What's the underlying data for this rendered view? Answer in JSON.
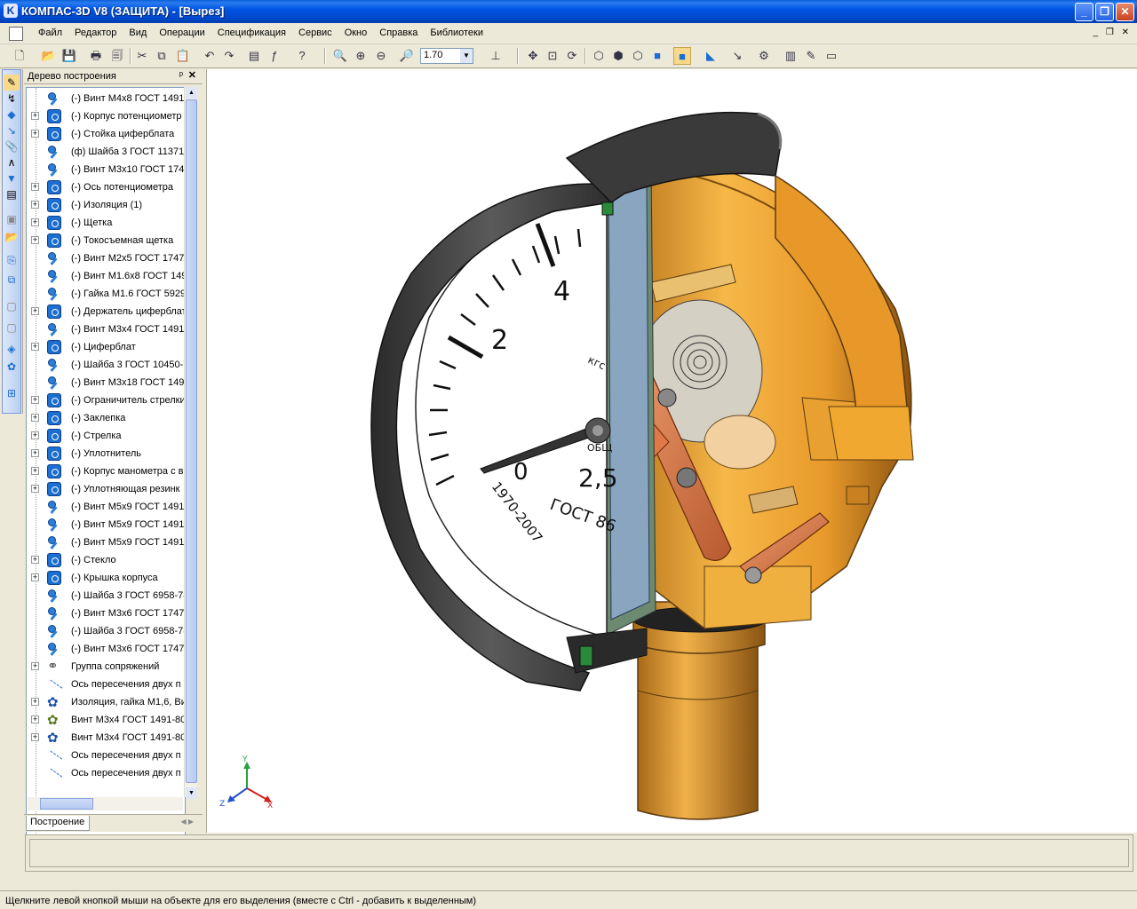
{
  "window": {
    "title": "КОМПАС-3D V8 (ЗАЩИТА) - [Вырез]",
    "minimize": "_",
    "maximize": "❐",
    "close": "✕"
  },
  "menu": [
    "Файл",
    "Редактор",
    "Вид",
    "Операции",
    "Спецификация",
    "Сервис",
    "Окно",
    "Справка",
    "Библиотеки"
  ],
  "toolbar": {
    "zoom_value": "1.70"
  },
  "tree": {
    "header": "Дерево построения",
    "tab": "Построение",
    "items": [
      {
        "label": "(-) Винт М4х8 ГОСТ 1491-",
        "icon": "bolt-icon",
        "expand": false
      },
      {
        "label": "(-) Корпус потенциометр",
        "icon": "part-icon",
        "expand": true
      },
      {
        "label": "(-) Стойка циферблата",
        "icon": "part-icon",
        "expand": true
      },
      {
        "label": "(ф) Шайба 3 ГОСТ 11371-",
        "icon": "bolt-icon",
        "expand": false
      },
      {
        "label": "(-) Винт М3х10 ГОСТ 1747",
        "icon": "bolt-icon",
        "expand": false
      },
      {
        "label": "(-) Ось потенциометра",
        "icon": "part-icon",
        "expand": true
      },
      {
        "label": "(-) Изоляция (1)",
        "icon": "part-icon",
        "expand": true
      },
      {
        "label": "(-) Щетка",
        "icon": "part-icon",
        "expand": true
      },
      {
        "label": "(-) Токосъемная щетка",
        "icon": "part-icon",
        "expand": true
      },
      {
        "label": "(-) Винт М2х5 ГОСТ 17473",
        "icon": "bolt-icon",
        "expand": false
      },
      {
        "label": "(-) Винт М1.6х8 ГОСТ 149",
        "icon": "bolt-icon",
        "expand": false
      },
      {
        "label": "(-) Гайка М1.6 ГОСТ 5929",
        "icon": "bolt-icon",
        "expand": false
      },
      {
        "label": "(-) Держатель циферблат",
        "icon": "part-icon",
        "expand": true
      },
      {
        "label": "(-) Винт М3х4 ГОСТ 1491-",
        "icon": "bolt-icon",
        "expand": false
      },
      {
        "label": "(-) Циферблат",
        "icon": "part-icon",
        "expand": true
      },
      {
        "label": "(-) Шайба 3 ГОСТ 10450-7",
        "icon": "bolt-icon",
        "expand": false
      },
      {
        "label": "(-) Винт М3х18 ГОСТ 149:",
        "icon": "bolt-icon",
        "expand": false
      },
      {
        "label": "(-) Ограничитель стрелки",
        "icon": "part-icon",
        "expand": true
      },
      {
        "label": "(-) Заклепка",
        "icon": "part-icon",
        "expand": true
      },
      {
        "label": "(-) Стрелка",
        "icon": "part-icon",
        "expand": true
      },
      {
        "label": "(-) Уплотнитель",
        "icon": "part-icon",
        "expand": true
      },
      {
        "label": "(-) Корпус манометра с в",
        "icon": "part-icon",
        "expand": true
      },
      {
        "label": "(-) Уплотняющая резинк",
        "icon": "part-icon",
        "expand": true
      },
      {
        "label": "(-) Винт М5х9 ГОСТ 1491-",
        "icon": "bolt-icon",
        "expand": false
      },
      {
        "label": "(-) Винт М5х9 ГОСТ 1491-",
        "icon": "bolt-icon",
        "expand": false
      },
      {
        "label": "(-) Винт М5х9 ГОСТ 1491-",
        "icon": "bolt-icon",
        "expand": false
      },
      {
        "label": "(-) Стекло",
        "icon": "part-icon",
        "expand": true
      },
      {
        "label": "(-) Крышка корпуса",
        "icon": "part-icon",
        "expand": true
      },
      {
        "label": "(-) Шайба 3 ГОСТ 6958-78",
        "icon": "bolt-icon",
        "expand": false
      },
      {
        "label": "(-) Винт М3х6 ГОСТ 17473",
        "icon": "bolt-icon",
        "expand": false
      },
      {
        "label": "(-) Шайба 3 ГОСТ 6958-78",
        "icon": "bolt-icon",
        "expand": false
      },
      {
        "label": "(-) Винт М3х6 ГОСТ 17473",
        "icon": "bolt-icon",
        "expand": false
      },
      {
        "label": "Группа сопряжений",
        "icon": "group-icon",
        "expand": true
      },
      {
        "label": "Ось пересечения двух п",
        "icon": "axis-icon",
        "expand": false
      },
      {
        "label": "Изоляция, гайка М1,6, Ви",
        "icon": "array-icon",
        "expand": true
      },
      {
        "label": "Винт М3х4 ГОСТ 1491-80",
        "icon": "array2-icon",
        "expand": true
      },
      {
        "label": "Винт М3х4 ГОСТ 1491-80",
        "icon": "array-icon",
        "expand": true
      },
      {
        "label": "Ось пересечения двух п",
        "icon": "axis-icon",
        "expand": false
      },
      {
        "label": "Ось пересечения двух п",
        "icon": "axis-icon",
        "expand": false
      }
    ]
  },
  "model": {
    "dial_numbers": [
      "2",
      "4",
      "0",
      "2,5"
    ],
    "dial_text": [
      "ГОСТ 86",
      "1970-2007",
      "кгс",
      "ОБЩ"
    ],
    "axes": [
      "Y",
      "Z",
      "X"
    ]
  },
  "status": {
    "hint": "Щелкните левой кнопкой мыши на объекте для его выделения (вместе с Ctrl - добавить к выделенным)"
  },
  "colors": {
    "titlebar": "#0054e3",
    "body_orange": "#f0a830",
    "shell_dark": "#3c3c3c"
  }
}
